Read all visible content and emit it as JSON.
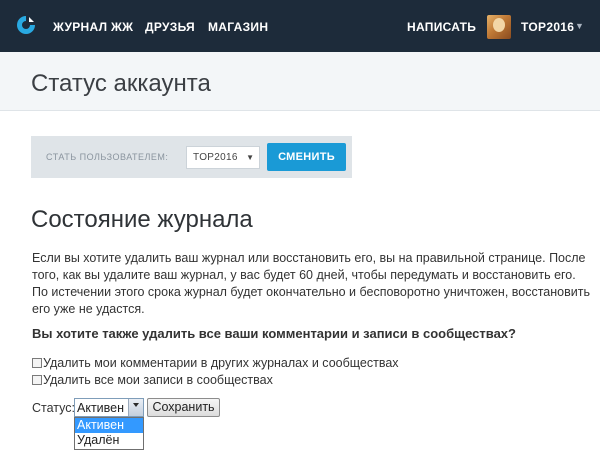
{
  "nav": {
    "logo_icon": "livejournal-logo-icon",
    "links": [
      "ЖУРНАЛ ЖЖ",
      "ДРУЗЬЯ",
      "МАГАЗИН"
    ],
    "write_label": "НАПИСАТЬ",
    "username": "TOP2016",
    "user_menu_icon": "caret-down-icon"
  },
  "page": {
    "title": "Статус аккаунта"
  },
  "switch_user": {
    "label": "СТАТЬ ПОЛЬЗОВАТЕЛЕМ:",
    "selected": "TOP2016",
    "button": "СМЕНИТЬ"
  },
  "journal_state": {
    "title": "Состояние журнала",
    "description": "Если вы хотите удалить ваш журнал или восстановить его, вы на правильной странице. После того, как вы удалите ваш журнал, у вас будет 60 дней, чтобы передумать и восстановить его. По истечении этого срока журнал будет окончательно и бесповоротно уничтожен, восстановить его уже не удастся.",
    "question": "Вы хотите также удалить все ваши комментарии и записи в сообществах?",
    "checkboxes": [
      {
        "label": "Удалить мои комментарии в других журналах и сообществах",
        "checked": false
      },
      {
        "label": "Удалить все мои записи в сообществах",
        "checked": false
      }
    ],
    "status_label": "Статус:",
    "status_value": "Активен",
    "status_options": [
      "Активен",
      "Удалён"
    ],
    "save_button": "Сохранить"
  },
  "colors": {
    "nav_bg": "#1d2b3a",
    "accent": "#1a9ad6",
    "option_highlight": "#3399ff"
  }
}
